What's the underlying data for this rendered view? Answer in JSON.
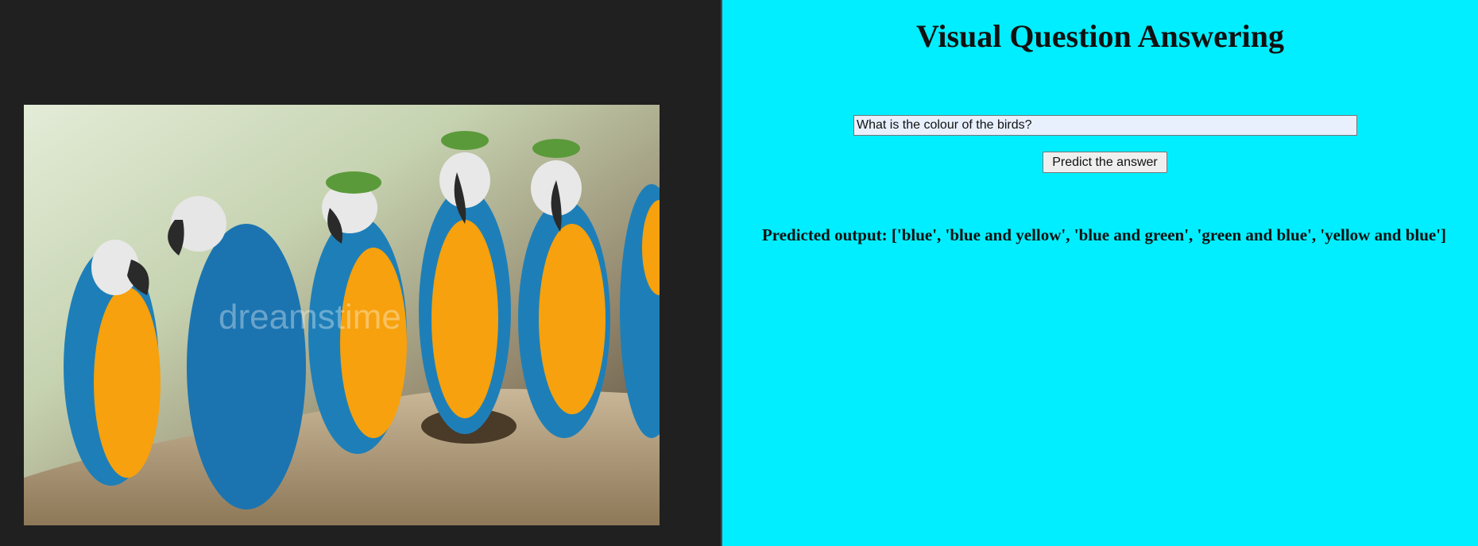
{
  "header": {
    "title": "Visual Question Answering"
  },
  "form": {
    "question_value": "What is the colour of the birds?",
    "predict_label": "Predict the answer"
  },
  "result": {
    "text": "Predicted output: ['blue', 'blue and yellow', 'blue and green', 'green and blue', 'yellow and blue']"
  },
  "image": {
    "watermark": "dreamstime",
    "colors": {
      "left_background": "#202020",
      "right_background": "#00eeff",
      "macaw_blue": "#1e7fb8",
      "macaw_yellow": "#f6a10d",
      "branch": "#b09a7a"
    }
  }
}
